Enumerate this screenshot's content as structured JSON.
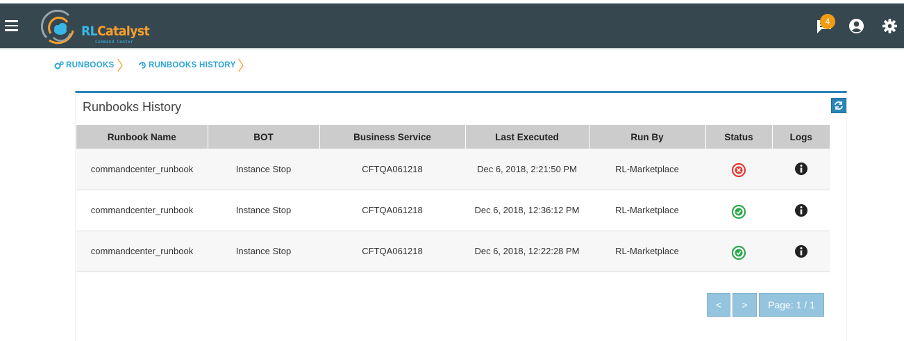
{
  "app": {
    "logo_text_primary": "RL",
    "logo_text_secondary": "Catalyst",
    "logo_subtext": "Command Center",
    "notification_count": "4",
    "colors": {
      "topbar": "#37474f",
      "accent": "#2a86b8",
      "link": "#2aa4d6",
      "error": "#e53935",
      "success": "#2fa84f",
      "badge": "#f39c12"
    }
  },
  "header_icons": [
    "menu-icon",
    "notifications-icon",
    "account-icon",
    "settings-icon"
  ],
  "breadcrumb": [
    {
      "label": "RUNBOOKS",
      "icon": "cogs-icon"
    },
    {
      "label": "RUNBOOKS HISTORY",
      "icon": "history-icon"
    }
  ],
  "panel": {
    "title": "Runbooks History",
    "refresh_icon": "refresh-icon"
  },
  "table": {
    "columns": [
      "Runbook Name",
      "BOT",
      "Business Service",
      "Last Executed",
      "Run By",
      "Status",
      "Logs"
    ],
    "rows": [
      {
        "runbook_name": "commandcenter_runbook",
        "bot": "Instance Stop",
        "business_service": "CFTQA061218",
        "last_executed": "Dec 6, 2018, 2:21:50 PM",
        "run_by": "RL-Marketplace",
        "status": "failed",
        "logs_icon": "info-icon"
      },
      {
        "runbook_name": "commandcenter_runbook",
        "bot": "Instance Stop",
        "business_service": "CFTQA061218",
        "last_executed": "Dec 6, 2018, 12:36:12 PM",
        "run_by": "RL-Marketplace",
        "status": "success",
        "logs_icon": "info-icon"
      },
      {
        "runbook_name": "commandcenter_runbook",
        "bot": "Instance Stop",
        "business_service": "CFTQA061218",
        "last_executed": "Dec 6, 2018, 12:22:28 PM",
        "run_by": "RL-Marketplace",
        "status": "success",
        "logs_icon": "info-icon"
      }
    ]
  },
  "pagination": {
    "prev_label": "<",
    "next_label": ">",
    "page_label": "Page: 1 / 1"
  }
}
